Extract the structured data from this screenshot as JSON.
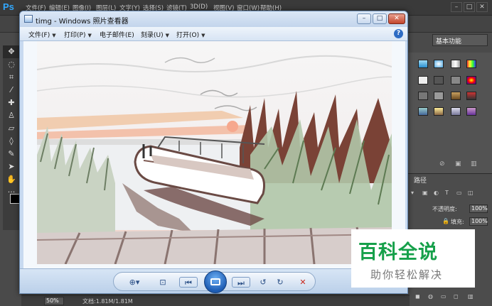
{
  "photoshop": {
    "logo": "Ps",
    "menu": [
      "文件(F)",
      "编辑(E)",
      "图像(I)",
      "图层(L)",
      "文字(Y)",
      "选择(S)",
      "滤镜(T)",
      "3D(D)",
      "视图(V)",
      "窗口(W)",
      "帮助(H)"
    ],
    "workspace": "基本功能",
    "window_controls": [
      "–",
      "□",
      "✕"
    ],
    "tools": [
      "move-icon",
      "lasso-icon",
      "crop-icon",
      "eyedropper-icon",
      "healing-icon",
      "brush-icon",
      "stamp-icon",
      "eraser-icon",
      "bucket-icon",
      "pen-icon",
      "path-select-icon",
      "hand-icon",
      "more-icon"
    ],
    "layers_panel": {
      "tab": "路径",
      "opacity_label": "不透明度:",
      "opacity_value": "100%",
      "fill_label": "填充:",
      "fill_value": "100%"
    },
    "status": {
      "zoom": "50%",
      "doc_info": "文档:1.81M/1.81M"
    }
  },
  "viewer": {
    "title": "timg - Windows 照片查看器",
    "menu": [
      "文件(F)",
      "打印(P)",
      "电子邮件(E)",
      "刻录(U)",
      "打开(O)"
    ],
    "help": "?",
    "title_buttons": [
      "–",
      "□",
      "✕"
    ]
  },
  "watermark": {
    "title": "百科全说",
    "subtitle": "助你轻松解决"
  },
  "colors": {
    "viewer_chrome": "#c8daf0",
    "ps_dark": "#4a4a4a",
    "watermark_green": "#16a04a"
  }
}
